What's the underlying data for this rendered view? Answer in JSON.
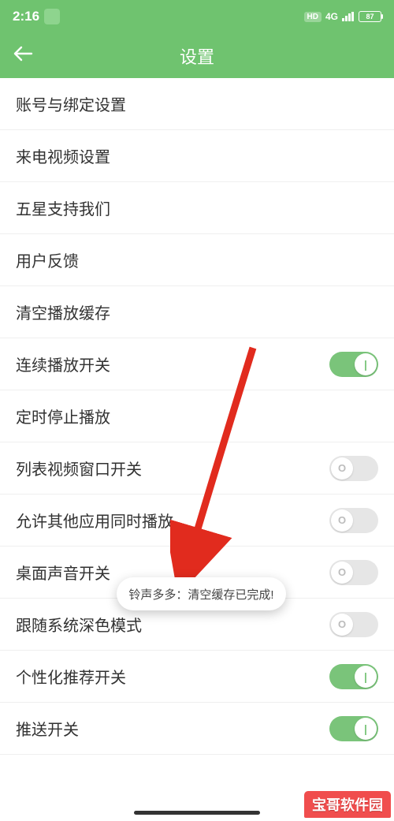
{
  "statusbar": {
    "time": "2:16",
    "hd": "HD",
    "network": "4G",
    "battery": "87"
  },
  "header": {
    "title": "设置"
  },
  "rows": {
    "account": "账号与绑定设置",
    "incoming_video": "来电视频设置",
    "five_star": "五星支持我们",
    "feedback": "用户反馈",
    "clear_cache": "清空播放缓存",
    "continuous_play": "连续播放开关",
    "timed_stop": "定时停止播放",
    "list_video_window": "列表视频窗口开关",
    "allow_concurrent": "允许其他应用同时播放",
    "desktop_sound": "桌面声音开关",
    "follow_dark": "跟随系统深色模式",
    "personalized": "个性化推荐开关",
    "push": "推送开关"
  },
  "toggles": {
    "continuous_play": true,
    "list_video_window": false,
    "allow_concurrent": false,
    "desktop_sound": false,
    "follow_dark": false,
    "personalized": true,
    "push": true
  },
  "toast": {
    "text": "铃声多多：清空缓存已完成!"
  },
  "watermark": "宝哥软件园"
}
